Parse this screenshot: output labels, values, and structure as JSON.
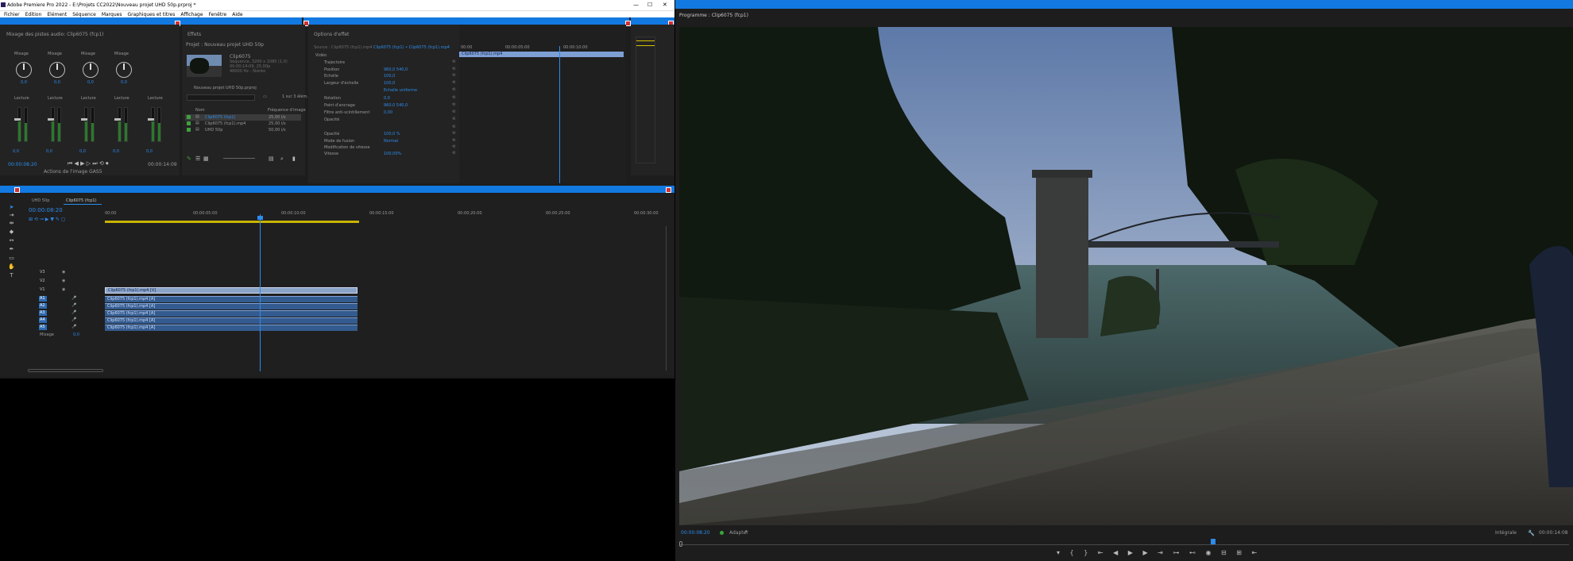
{
  "titlebar": {
    "title": "Adobe Premiere Pro 2022 - E:\\Projets CC2022\\Nouveau projet UHD 50p.prproj *"
  },
  "menu": [
    "Fichier",
    "Edition",
    "Elément",
    "Séquence",
    "Marques",
    "Graphiques et titres",
    "Affichage",
    "Fenêtre",
    "Aide"
  ],
  "mixer": {
    "tab": "Mixage des pistes audio: Clip6075 (fcp1)",
    "channels": [
      {
        "name": "Mixage",
        "value": "0,0",
        "mode": "Lecture",
        "db": "0,0"
      },
      {
        "name": "Mixage",
        "value": "0,0",
        "mode": "Lecture",
        "db": "0,0"
      },
      {
        "name": "Mixage",
        "value": "0,0",
        "mode": "Lecture",
        "db": "0,0"
      },
      {
        "name": "Mixage",
        "value": "0,0",
        "mode": "Lecture",
        "db": "0,0"
      },
      {
        "name": "",
        "value": "",
        "mode": "Lecture",
        "db": "0,0"
      }
    ],
    "timecode": "00:00:08:20",
    "duration": "00:00:14:09",
    "footer": "Actions de l'image GAS5"
  },
  "effects": {
    "tab": "Effets"
  },
  "project": {
    "tab": "Projet : Nouveau projet UHD 50p",
    "clip_name": "Clip6075",
    "clip_line2": "Séquence, 3200 x 1080 (1,0)",
    "clip_line3": "00:00:14:09, 25,00p",
    "clip_line4": "48000 Hz - Stéréo",
    "file": "Nouveau projet UHD 50p.prproj",
    "count": "1 sur 3 élém.",
    "col_name": "Nom",
    "col_rate": "Fréquence d'image",
    "items": [
      {
        "name": "Clip6075 (fcp1)",
        "rate": "25,00 i/s"
      },
      {
        "name": "Clip6075 (fcp1).mp4",
        "rate": "25,00 i/s"
      },
      {
        "name": "UHD 50p",
        "rate": "50,00 i/s"
      }
    ]
  },
  "effect_options": {
    "tab": "Options d'effet",
    "source": "Source : Clip6075 (fcp1).mp4",
    "seq": "Clip6075 (fcp1) • Clip6075 (fcp1).mp4",
    "tc_start": "00:00",
    "tc_mid": "00:00:05:00",
    "tc_end": "00:00:10:00",
    "clip_label": "Clip6075 (fcp1).mp4",
    "video_label": "Vidéo",
    "rows": [
      {
        "label": "Trajectoire",
        "value": ""
      },
      {
        "label": "Position",
        "value": "960,0    540,0"
      },
      {
        "label": "Echelle",
        "value": "100,0"
      },
      {
        "label": "Largeur d'échelle",
        "value": "100,0"
      },
      {
        "label": "",
        "value": "Echelle uniforme"
      },
      {
        "label": "Rotation",
        "value": "0,0"
      },
      {
        "label": "Point d'ancrage",
        "value": "960,0    540,0"
      },
      {
        "label": "Filtre anti-scintillement",
        "value": "0,00"
      },
      {
        "label": "Opacité",
        "value": ""
      },
      {
        "label": "",
        "value": ""
      },
      {
        "label": "Opacité",
        "value": "100,0 %"
      },
      {
        "label": "Mode de fusion",
        "value": "Normal"
      },
      {
        "label": "Modification de vitesse",
        "value": ""
      },
      {
        "label": "Vitesse",
        "value": "100,00%"
      }
    ]
  },
  "timeline": {
    "tabs": [
      "UHD 50p",
      "Clip6075 (fcp1)"
    ],
    "timecode": "00:00:08:20",
    "ruler": [
      "00:00",
      "00:00:05:00",
      "00:00:10:00",
      "00:00:15:00",
      "00:00:20:00",
      "00:00:25:00",
      "00:00:30:00"
    ],
    "video_tracks": [
      "V3",
      "V2",
      "V1"
    ],
    "audio_tracks": [
      "A1",
      "A2",
      "A3",
      "A4",
      "A5"
    ],
    "video_clip": "Clip6075 (fcp1).mp4 [V]",
    "audio_clip": "Clip6075 (fcp1).mp4 [A]",
    "mix_label": "Mixage",
    "mix_value": "0,0"
  },
  "program": {
    "tab": "Programme : Clip6075 (fcp1)",
    "timecode": "00:00:08:20",
    "fit": "Adapter",
    "quality": "Intégrale",
    "duration": "00:00:14:08",
    "playhead": 0.6
  },
  "colors": {
    "accent": "#2d8ceb",
    "highlight": "#1279e0",
    "close": "#d23030"
  }
}
